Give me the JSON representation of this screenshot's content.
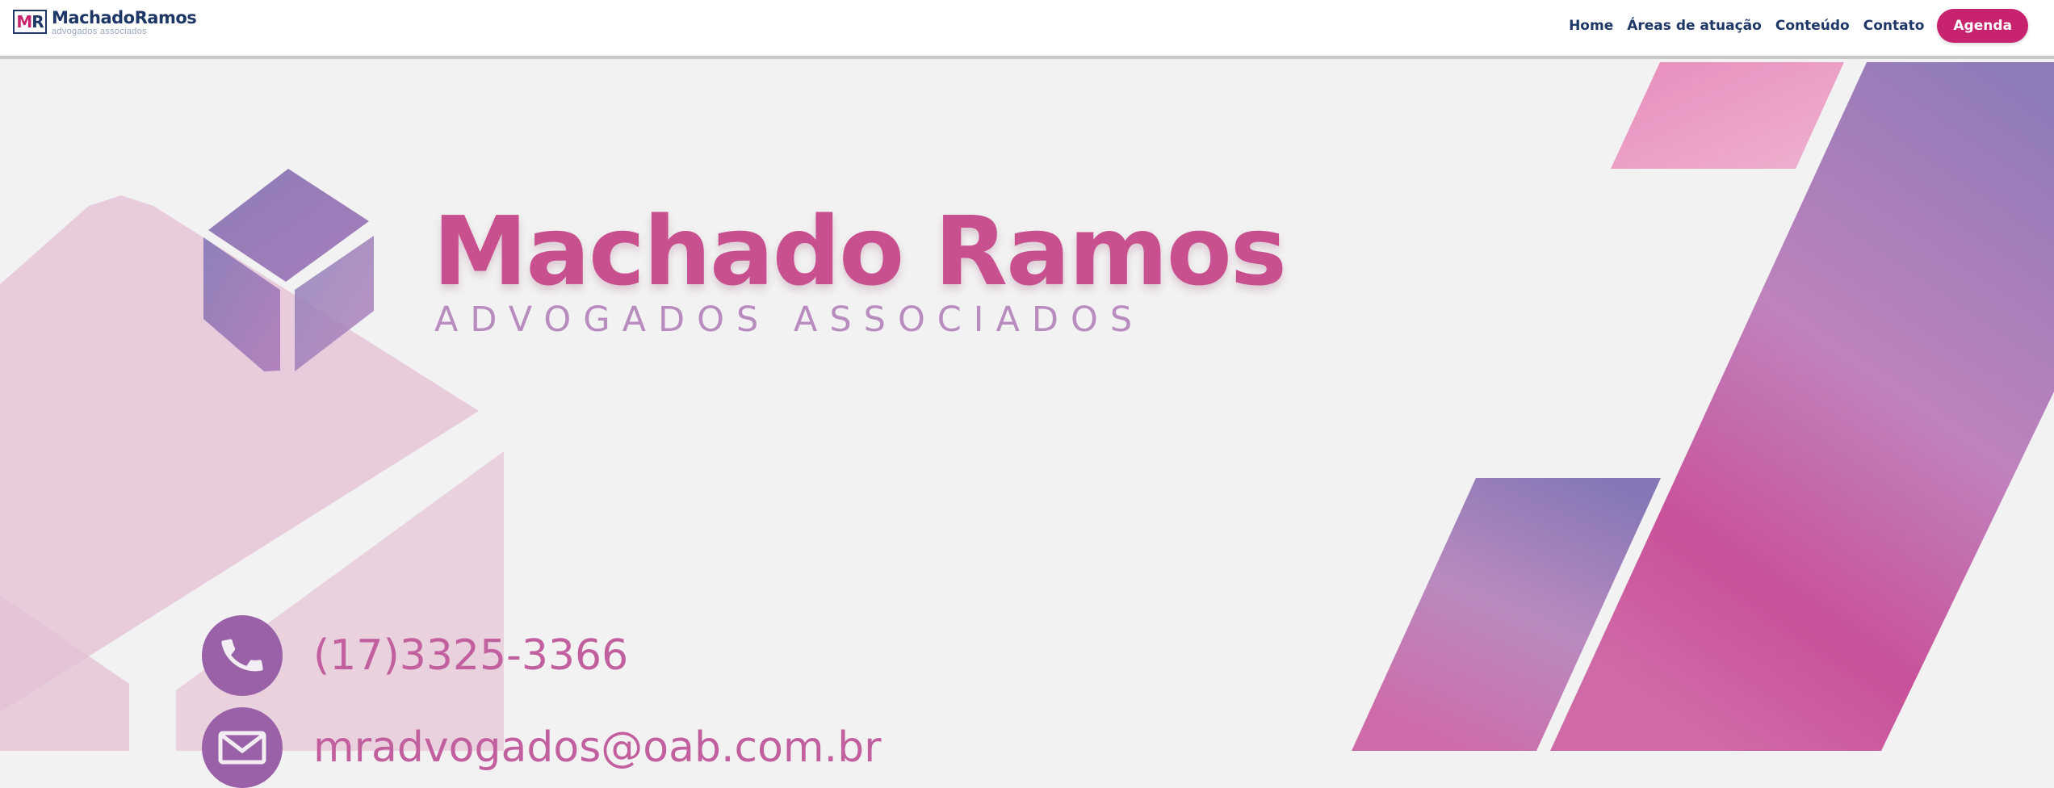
{
  "header": {
    "logo_mark_m": "M",
    "logo_mark_r": "R",
    "logo_name": "MachadoRamos",
    "logo_sub": "advogados associados",
    "nav": [
      "Home",
      "Áreas de atuação",
      "Conteúdo",
      "Contato"
    ],
    "cta": "Agenda"
  },
  "hero": {
    "title": "Machado Ramos",
    "subtitle": "ADVOGADOS ASSOCIADOS",
    "phone": "(17)3325-3366",
    "email": "mradvogados@oab.com.br"
  },
  "icons": [
    "cube-icon",
    "phone-icon",
    "mail-icon"
  ],
  "colors": {
    "brand_navy": "#1e3766",
    "brand_magenta": "#c8236f",
    "title_pink": "#c8508e",
    "subtitle_lilac": "#b98cc0",
    "icon_purple": "#9a61a8",
    "background": "#f2f2f2"
  }
}
